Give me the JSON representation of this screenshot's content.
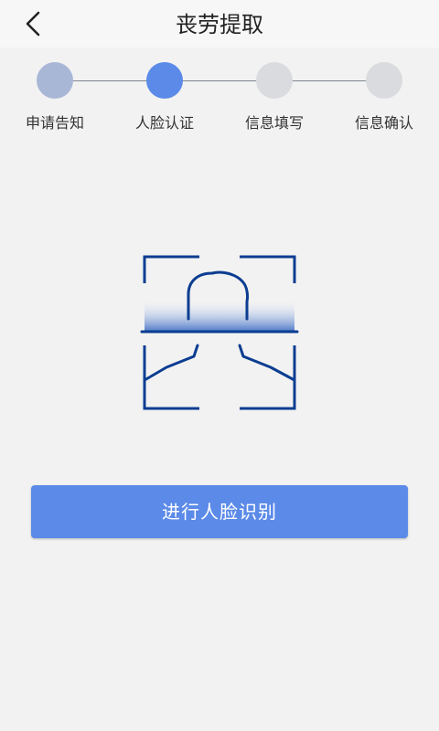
{
  "header": {
    "title": "丧劳提取",
    "back_icon": "chevron-left-icon"
  },
  "steps": [
    {
      "label": "申请告知",
      "state": "done",
      "color": "#a9b7d6"
    },
    {
      "label": "人脸认证",
      "state": "active",
      "color": "#5b8ae8"
    },
    {
      "label": "信息填写",
      "state": "pending",
      "color": "#d9dbde"
    },
    {
      "label": "信息确认",
      "state": "pending",
      "color": "#d9dbde"
    }
  ],
  "illustration": {
    "icon": "face-scan-icon",
    "stroke_color": "#0b3d91"
  },
  "action": {
    "button_label": "进行人脸识别",
    "color": "#5b8ae8"
  }
}
